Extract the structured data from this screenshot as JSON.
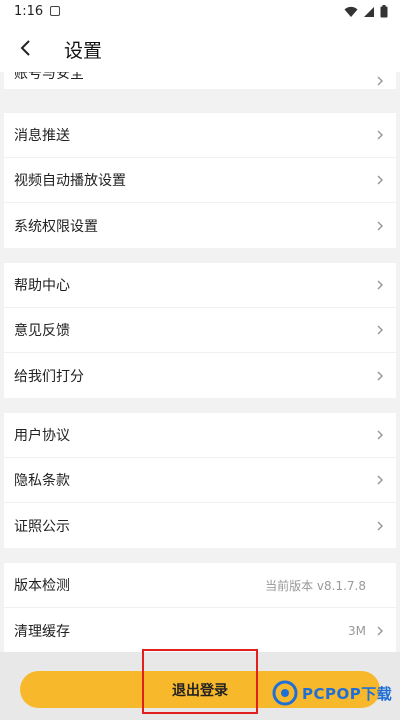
{
  "status_bar": {
    "time": "1:16"
  },
  "nav": {
    "title": "设置"
  },
  "groups": [
    {
      "items": [
        {
          "label": "账号与安全"
        }
      ]
    },
    {
      "items": [
        {
          "label": "消息推送"
        },
        {
          "label": "视频自动播放设置"
        },
        {
          "label": "系统权限设置"
        }
      ]
    },
    {
      "items": [
        {
          "label": "帮助中心"
        },
        {
          "label": "意见反馈"
        },
        {
          "label": "给我们打分"
        }
      ]
    },
    {
      "items": [
        {
          "label": "用户协议"
        },
        {
          "label": "隐私条款"
        },
        {
          "label": "证照公示"
        }
      ]
    },
    {
      "items": [
        {
          "label": "版本检测",
          "value": "当前版本 v8.1.7.8"
        },
        {
          "label": "清理缓存",
          "value": "3M"
        }
      ]
    }
  ],
  "logout": {
    "label": "退出登录"
  },
  "watermark": {
    "text": "PCPOP下载"
  },
  "colors": {
    "accent": "#f7b82c",
    "highlight": "#e01f1f",
    "watermark": "#1f6fd6"
  }
}
